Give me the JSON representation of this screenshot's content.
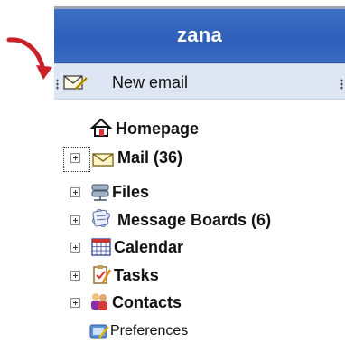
{
  "header": {
    "user": "zana"
  },
  "toolbar": {
    "new_email_label": "New email"
  },
  "tree": {
    "homepage": "Homepage",
    "mail": "Mail (36)",
    "files": "Files",
    "boards": "Message Boards (6)",
    "calendar": "Calendar",
    "tasks": "Tasks",
    "contacts": "Contacts",
    "preferences": "Preferences"
  },
  "colors": {
    "header_blue": "#2f5fb8",
    "toolbar_bg": "#dfe6f3",
    "arrow_red": "#c9202a"
  }
}
